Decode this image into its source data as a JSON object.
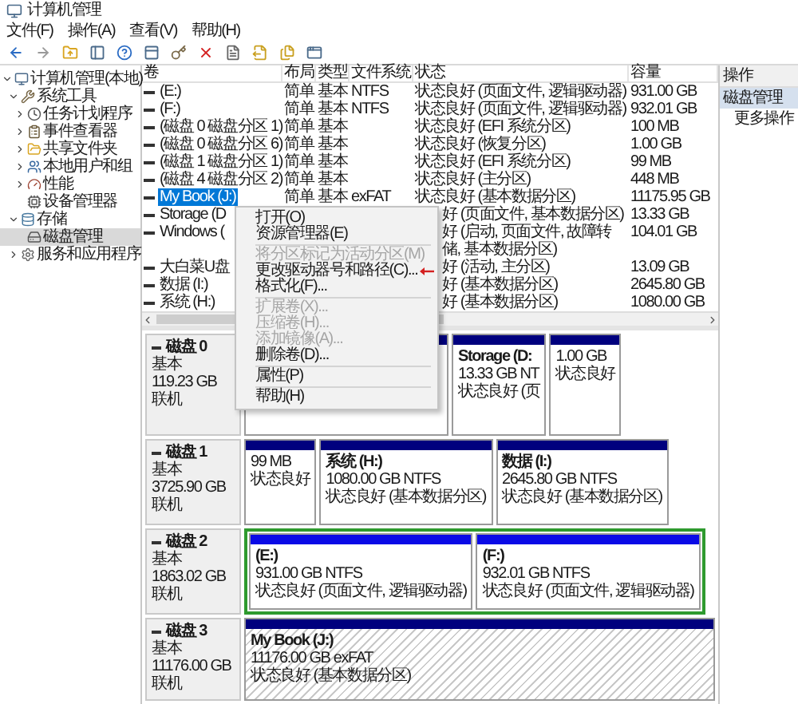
{
  "window": {
    "title": "计算机管理"
  },
  "menu_bar": [
    "文件(F)",
    "操作(A)",
    "查看(V)",
    "帮助(H)"
  ],
  "tree": [
    {
      "label": "计算机管理(本地)",
      "expanded": true,
      "selected": false,
      "children": [
        {
          "label": "系统工具",
          "expanded": true,
          "selected": false,
          "children": [
            {
              "label": "任务计划程序",
              "expanded": false,
              "selected": false
            },
            {
              "label": "事件查看器",
              "expanded": false,
              "selected": false
            },
            {
              "label": "共享文件夹",
              "expanded": false,
              "selected": false
            },
            {
              "label": "本地用户和组",
              "expanded": false,
              "selected": false
            },
            {
              "label": "性能",
              "expanded": false,
              "selected": false
            },
            {
              "label": "设备管理器",
              "selected": false
            }
          ]
        },
        {
          "label": "存储",
          "expanded": true,
          "selected": false,
          "children": [
            {
              "label": "磁盘管理",
              "selected": true
            }
          ]
        },
        {
          "label": "服务和应用程序",
          "expanded": false,
          "selected": false
        }
      ]
    }
  ],
  "volume_table": {
    "columns": [
      "卷",
      "布局",
      "类型",
      "文件系统",
      "状态",
      "容量"
    ],
    "rows": [
      {
        "kind": "full",
        "volume": "(E:)",
        "layout": "简单",
        "type": "基本",
        "file_system": "NTFS",
        "status": "状态良好 (页面文件, 逻辑驱动器)",
        "capacity": "931.00 GB",
        "selected": false
      },
      {
        "kind": "full",
        "volume": "(F:)",
        "layout": "简单",
        "type": "基本",
        "file_system": "NTFS",
        "status": "状态良好 (页面文件, 逻辑驱动器)",
        "capacity": "932.01 GB",
        "selected": false
      },
      {
        "kind": "full",
        "volume": "(磁盘 0 磁盘分区 1)",
        "layout": "简单",
        "type": "基本",
        "status": "状态良好 (EFI 系统分区)",
        "capacity": "100 MB",
        "selected": false
      },
      {
        "kind": "full",
        "volume": "(磁盘 0 磁盘分区 6)",
        "layout": "简单",
        "type": "基本",
        "status": "状态良好 (恢复分区)",
        "capacity": "1.00 GB",
        "selected": false
      },
      {
        "kind": "full",
        "volume": "(磁盘 1 磁盘分区 1)",
        "layout": "简单",
        "type": "基本",
        "status": "状态良好 (EFI 系统分区)",
        "capacity": "99 MB",
        "selected": false
      },
      {
        "kind": "full",
        "volume": "(磁盘 4 磁盘分区 2)",
        "layout": "简单",
        "type": "基本",
        "status": "状态良好 (主分区)",
        "capacity": "448 MB",
        "selected": false
      },
      {
        "kind": "full",
        "volume": "My Book (J:)",
        "layout": "简单",
        "type": "基本",
        "file_system": "exFAT",
        "status": "状态良好 (基本数据分区)",
        "capacity": "11175.95 GB",
        "selected": true
      },
      {
        "kind": "covered",
        "volume": "Storage (D",
        "status": "好 (页面文件, 基本数据分区)",
        "capacity": "13.33 GB",
        "selected": false
      },
      {
        "kind": "covered",
        "volume": "Windows (",
        "status": "好 (启动, 页面文件, 故障转储, 基本数据分区)",
        "capacity": "104.01 GB",
        "selected": false
      },
      {
        "kind": "covered",
        "volume": "大白菜U盘",
        "status": "好 (活动, 主分区)",
        "capacity": "13.09 GB",
        "selected": false
      },
      {
        "kind": "covered",
        "volume": "数据 (I:)",
        "status": "好 (基本数据分区)",
        "capacity": "2645.80 GB",
        "selected": false
      },
      {
        "kind": "covered",
        "volume": "系统 (H:)",
        "status": "好 (基本数据分区)",
        "capacity": "1080.00 GB",
        "selected": false
      }
    ]
  },
  "disks": [
    {
      "name": "磁盘 0",
      "type": "基本",
      "size": "119.23 GB",
      "status": "联机",
      "extended": false,
      "partitions": [
        {
          "kind": "covered",
          "selected": false
        },
        {
          "kind": "primary",
          "title": "Storage (D:",
          "detail": "13.33 GB NT",
          "status": "状态良好 (页",
          "selected": false
        },
        {
          "kind": "primary",
          "detail": "1.00 GB",
          "status": "状态良好",
          "selected": false
        }
      ]
    },
    {
      "name": "磁盘 1",
      "type": "基本",
      "size": "3725.90 GB",
      "status": "联机",
      "extended": false,
      "partitions": [
        {
          "kind": "primary",
          "detail": "99 MB",
          "status": "状态良好",
          "selected": false
        },
        {
          "kind": "primary",
          "title": "系统 (H:)",
          "detail": "1080.00 GB NTFS",
          "status": "状态良好 (基本数据分区)",
          "selected": false
        },
        {
          "kind": "primary",
          "title": "数据 (I:)",
          "detail": "2645.80 GB NTFS",
          "status": "状态良好 (基本数据分区)",
          "selected": false
        }
      ]
    },
    {
      "name": "磁盘 2",
      "type": "基本",
      "size": "1863.02 GB",
      "status": "联机",
      "extended": true,
      "partitions": [
        {
          "kind": "logical",
          "title": "(E:)",
          "detail": "931.00 GB NTFS",
          "status": "状态良好 (页面文件, 逻辑驱动器)",
          "selected": false
        },
        {
          "kind": "logical",
          "title": "(F:)",
          "detail": "932.01 GB NTFS",
          "status": "状态良好 (页面文件, 逻辑驱动器)",
          "selected": false
        }
      ]
    },
    {
      "name": "磁盘 3",
      "type": "基本",
      "size": "11176.00 GB",
      "status": "联机",
      "extended": false,
      "partitions": [
        {
          "kind": "primary",
          "title": "My Book (J:)",
          "detail": "11176.00 GB exFAT",
          "status": "状态良好 (基本数据分区)",
          "selected": true
        }
      ]
    }
  ],
  "context_menu": {
    "items": [
      {
        "kind": "item",
        "label": "打开(O)",
        "disabled": false,
        "pointed": false
      },
      {
        "kind": "item",
        "label": "资源管理器(E)",
        "disabled": false,
        "pointed": false
      },
      {
        "kind": "separator"
      },
      {
        "kind": "item",
        "label": "将分区标记为活动分区(M)",
        "disabled": true,
        "pointed": false
      },
      {
        "kind": "item",
        "label": "更改驱动器号和路径(C)...",
        "disabled": false,
        "pointed": true
      },
      {
        "kind": "item",
        "label": "格式化(F)...",
        "disabled": false,
        "pointed": false
      },
      {
        "kind": "separator"
      },
      {
        "kind": "item",
        "label": "扩展卷(X)...",
        "disabled": true,
        "pointed": false
      },
      {
        "kind": "item",
        "label": "压缩卷(H)...",
        "disabled": true,
        "pointed": false
      },
      {
        "kind": "item",
        "label": "添加镜像(A)...",
        "disabled": true,
        "pointed": false
      },
      {
        "kind": "item",
        "label": "删除卷(D)...",
        "disabled": false,
        "pointed": false
      },
      {
        "kind": "separator"
      },
      {
        "kind": "item",
        "label": "属性(P)",
        "disabled": false,
        "pointed": false
      },
      {
        "kind": "separator"
      },
      {
        "kind": "item",
        "label": "帮助(H)",
        "disabled": false,
        "pointed": false
      }
    ]
  },
  "actions": {
    "title": "操作",
    "section": "磁盘管理",
    "items": [
      "更多操作"
    ]
  }
}
